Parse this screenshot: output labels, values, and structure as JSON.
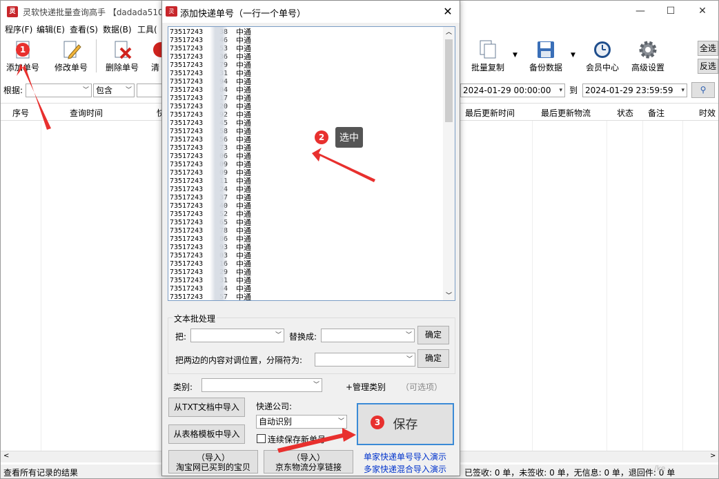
{
  "main_window": {
    "title": "灵软快递批量查询高手 【dadada510",
    "controls": {
      "minimize": "—",
      "maximize": "☐",
      "close": "✕"
    }
  },
  "menu": [
    "程序(F)",
    "编辑(E)",
    "查看(S)",
    "数据(B)",
    "工具("
  ],
  "toolbar": {
    "left": [
      {
        "label": "添加单号",
        "icon": "add-doc-icon"
      },
      {
        "label": "修改单号",
        "icon": "edit-pencil-icon"
      },
      {
        "label": "删除单号",
        "icon": "delete-x-icon"
      },
      {
        "label": "清",
        "icon": "clear-icon"
      }
    ],
    "right": [
      {
        "label": "批量复制",
        "icon": "copy-icon"
      },
      {
        "label": "备份数据",
        "icon": "floppy-icon"
      },
      {
        "label": "会员中心",
        "icon": "clock-user-icon"
      },
      {
        "label": "高级设置",
        "icon": "gear-icon"
      }
    ],
    "side_buttons": [
      "全选",
      "反选"
    ]
  },
  "filter": {
    "label": "根据:",
    "match": "包含",
    "date_from": "2024-01-29 00:00:00",
    "to_label": "到",
    "date_to": "2024-01-29 23:59:59"
  },
  "grid_headers": [
    "序号",
    "查询时间",
    "快",
    "最后更新时间",
    "最后更新物流",
    "状态",
    "备注",
    "时效"
  ],
  "statusbar": {
    "left": "查看所有记录的结果",
    "right": "已签收: 0 单，未签收: 0 单，无信息: 0 单，退回件: 0 单",
    "watermark": "/ke"
  },
  "dialog": {
    "title": "添加快递单号（一行一个单号）",
    "close": "✕",
    "entries": [
      {
        "prefix": "73517243",
        "suffix": "38",
        "company": "中通"
      },
      {
        "prefix": "73517243",
        "suffix": "46",
        "company": "中通"
      },
      {
        "prefix": "73517243",
        "suffix": "53",
        "company": "中通"
      },
      {
        "prefix": "73517243",
        "suffix": "36",
        "company": "中通"
      },
      {
        "prefix": "73517243",
        "suffix": "79",
        "company": "中通"
      },
      {
        "prefix": "73517243",
        "suffix": "31",
        "company": "中通"
      },
      {
        "prefix": "73517243",
        "suffix": "94",
        "company": "中通"
      },
      {
        "prefix": "73517243",
        "suffix": "04",
        "company": "中通"
      },
      {
        "prefix": "73517243",
        "suffix": "17",
        "company": "中通"
      },
      {
        "prefix": "73517243",
        "suffix": "20",
        "company": "中通"
      },
      {
        "prefix": "73517243",
        "suffix": "92",
        "company": "中通"
      },
      {
        "prefix": "73517243",
        "suffix": "45",
        "company": "中通"
      },
      {
        "prefix": "73517243",
        "suffix": "58",
        "company": "中通"
      },
      {
        "prefix": "73517243",
        "suffix": "56",
        "company": "中通"
      },
      {
        "prefix": "73517243",
        "suffix": "73",
        "company": "中通"
      },
      {
        "prefix": "73517243",
        "suffix": "06",
        "company": "中通"
      },
      {
        "prefix": "73517243",
        "suffix": "09",
        "company": "中通"
      },
      {
        "prefix": "73517243",
        "suffix": "09",
        "company": "中通"
      },
      {
        "prefix": "73517243",
        "suffix": "11",
        "company": "中通"
      },
      {
        "prefix": "73517243",
        "suffix": "24",
        "company": "中通"
      },
      {
        "prefix": "73517243",
        "suffix": "37",
        "company": "中通"
      },
      {
        "prefix": "73517243",
        "suffix": "40",
        "company": "中通"
      },
      {
        "prefix": "73517243",
        "suffix": "52",
        "company": "中通"
      },
      {
        "prefix": "73517243",
        "suffix": "65",
        "company": "中通"
      },
      {
        "prefix": "73517243",
        "suffix": "78",
        "company": "中通"
      },
      {
        "prefix": "73517243",
        "suffix": "86",
        "company": "中通"
      },
      {
        "prefix": "73517243",
        "suffix": "93",
        "company": "中通"
      },
      {
        "prefix": "73517243",
        "suffix": "03",
        "company": "中通"
      },
      {
        "prefix": "73517243",
        "suffix": "16",
        "company": "中通"
      },
      {
        "prefix": "73517243",
        "suffix": "29",
        "company": "中通"
      },
      {
        "prefix": "73517243",
        "suffix": "31",
        "company": "中通"
      },
      {
        "prefix": "73517243",
        "suffix": "44",
        "company": "中通"
      },
      {
        "prefix": "73517243",
        "suffix": "57",
        "company": "中通"
      }
    ],
    "text_batch": {
      "caption": "文本批处理",
      "replace_label": "把:",
      "replace_with_label": "替换成:",
      "confirm": "确定",
      "swap_label": "把两边的内容对调位置，分隔符为:",
      "confirm2": "确定"
    },
    "category_label": "类别:",
    "manage_category": "+管理类别",
    "optional": "（可选项）",
    "import_txt": "从TXT文档中导入",
    "import_table": "从表格模板中导入",
    "courier_label": "快递公司:",
    "courier_value": "自动识别",
    "continuous_save": "连续保存新单号",
    "save": "保存",
    "import_taobao_top": "（导入）",
    "import_taobao": "淘宝网已买到的宝贝",
    "import_jd_top": "（导入）",
    "import_jd": "京东物流分享链接",
    "link_single": "单家快递单号导入演示",
    "link_multi": "多家快递混合导入演示"
  },
  "annotations": {
    "step1": "1",
    "step2": "2",
    "step2_tip": "选中",
    "step3": "3",
    "arrow_color": "#e8302e"
  }
}
